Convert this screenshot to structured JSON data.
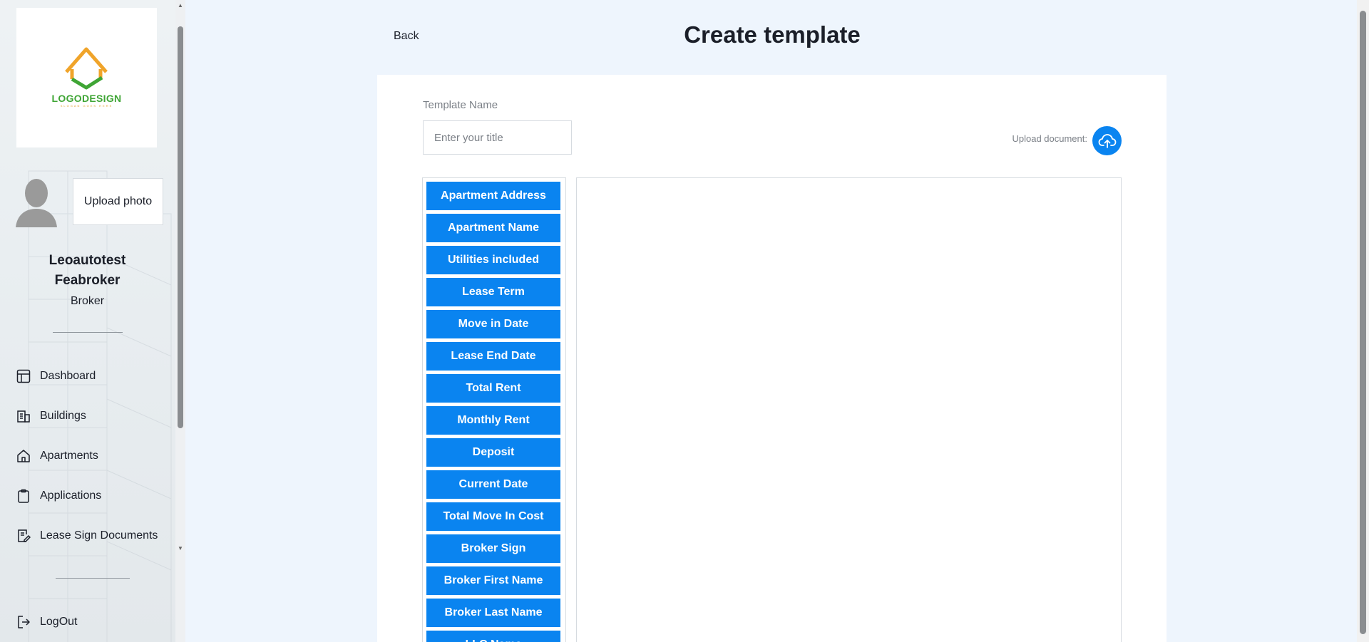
{
  "sidebar": {
    "logo": {
      "text": "LOGODESIGN",
      "tagline": "SLOGAN GOES HERE",
      "colors": {
        "house": "#f0a42a",
        "check": "#3fa535"
      }
    },
    "upload_photo_label": "Upload photo",
    "user": {
      "name": "Leoautotest Feabroker",
      "role": "Broker"
    },
    "nav": [
      {
        "label": "Dashboard",
        "icon": "dashboard-icon"
      },
      {
        "label": "Buildings",
        "icon": "building-icon"
      },
      {
        "label": "Apartments",
        "icon": "home-icon"
      },
      {
        "label": "Applications",
        "icon": "clipboard-icon"
      },
      {
        "label": "Lease Sign Documents",
        "icon": "document-sign-icon"
      }
    ],
    "logout_label": "LogOut"
  },
  "header": {
    "back_label": "Back",
    "title": "Create template"
  },
  "form": {
    "template_name_label": "Template Name",
    "template_name_placeholder": "Enter your title",
    "template_name_value": "",
    "upload_document_label": "Upload document:"
  },
  "field_buttons": [
    "Apartment Address",
    "Apartment Name",
    "Utilities included",
    "Lease Term",
    "Move in Date",
    "Lease End Date",
    "Total Rent",
    "Monthly Rent",
    "Deposit",
    "Current Date",
    "Total Move In Cost",
    "Broker Sign",
    "Broker First Name",
    "Broker Last Name",
    "LLC Name"
  ],
  "colors": {
    "accent": "#0a84f0",
    "background": "#eef5fd",
    "text": "#1b1f29"
  }
}
